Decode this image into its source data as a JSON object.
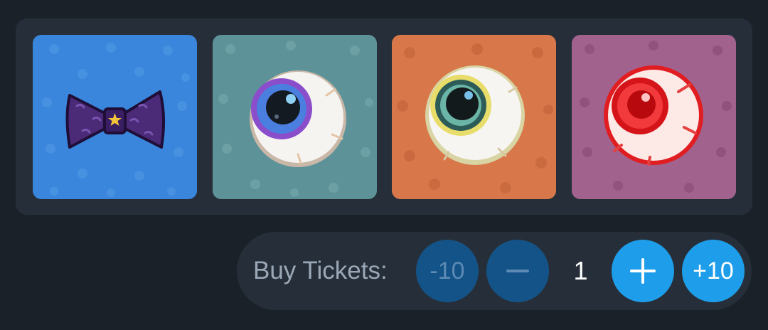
{
  "items": [
    {
      "name": "purple-bow-tie",
      "background": "#3a86dc"
    },
    {
      "name": "blue-eyeball",
      "background": "#5d9398"
    },
    {
      "name": "yellow-eyeball",
      "background": "#d8784a"
    },
    {
      "name": "red-eyeball",
      "background": "#a2628e"
    }
  ],
  "tickets": {
    "label": "Buy Tickets:",
    "minus10_label": "-10",
    "minus1_icon": "minus-icon",
    "quantity": "1",
    "plus1_icon": "plus-icon",
    "plus10_label": "+10"
  },
  "colors": {
    "page_background": "#1b2129",
    "panel_background": "#262f39",
    "button_disabled": "#145387",
    "button_active": "#1e9eea"
  }
}
